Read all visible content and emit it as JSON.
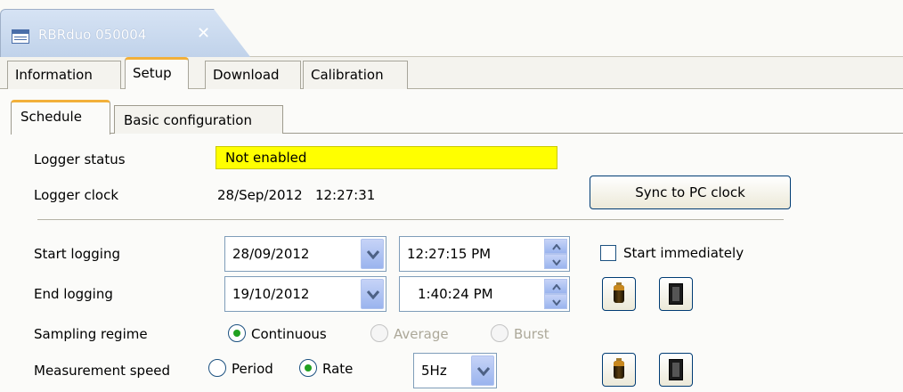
{
  "editor_tab": {
    "title": "RBRduo 050004",
    "close": "✕"
  },
  "outer_tabs": [
    "Information",
    "Setup",
    "Download",
    "Calibration"
  ],
  "inner_tabs": [
    "Schedule",
    "Basic configuration"
  ],
  "status": {
    "logger_status_label": "Logger status",
    "logger_status_value": "Not enabled",
    "logger_clock_label": "Logger clock",
    "logger_clock_value": "28/Sep/2012   12:27:31",
    "sync_button": "Sync to PC clock"
  },
  "schedule": {
    "start_label": "Start logging",
    "start_date": "28/09/2012",
    "start_time": "12:27:15 PM",
    "start_immediately": "Start immediately",
    "end_label": "End logging",
    "end_date": "19/10/2012",
    "end_time": "1:40:24 PM",
    "sampling_label": "Sampling regime",
    "sampling_options": [
      "Continuous",
      "Average",
      "Burst"
    ],
    "speed_label": "Measurement speed",
    "speed_options": [
      "Period",
      "Rate"
    ],
    "rate_value": "5Hz"
  },
  "icons": {
    "tab": "table-icon",
    "battery": "battery-icon",
    "memory": "memory-card-icon"
  }
}
